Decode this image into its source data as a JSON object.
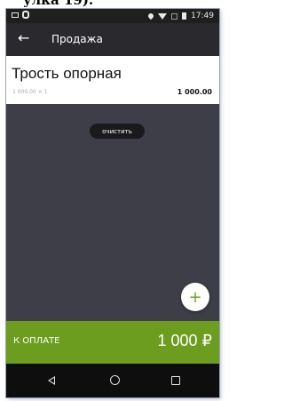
{
  "caption": "улка 19).",
  "status_bar": {
    "time": "17:49",
    "icons": [
      "notification-icon",
      "sync-icon",
      "location-icon",
      "wifi-icon",
      "no-signal-icon",
      "battery-icon"
    ]
  },
  "app_bar": {
    "back_icon": "←",
    "title": "Продажа"
  },
  "item": {
    "name": "Трость опорная",
    "qty_line": "1 000.00 × 1",
    "total": "1 000.00"
  },
  "clear_button": "очистить",
  "fab_icon": "+",
  "pay": {
    "label": "К ОПЛАТЕ",
    "amount": "1 000 ₽"
  },
  "colors": {
    "accent": "#6c9d1f",
    "app_bar": "#2a2a2e",
    "background": "#3d3e48"
  }
}
